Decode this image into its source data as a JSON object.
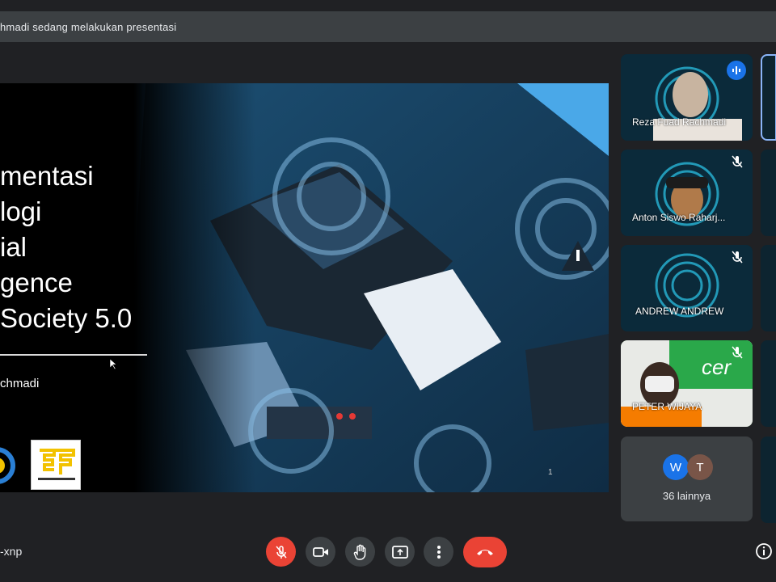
{
  "banner": {
    "text": "hmadi sedang melakukan presentasi"
  },
  "slide": {
    "title_lines": [
      "mentasi",
      "logi",
      "ial",
      "gence",
      "Society 5.0"
    ],
    "author": "chmadi",
    "page_number": "1"
  },
  "participants": [
    {
      "name": "Reza Fuad Rachmadi",
      "speaking": true
    },
    {
      "name": "Anton Siswo Raharj...",
      "muted": true
    },
    {
      "name": "ANDREW ANDREW",
      "muted": true
    },
    {
      "name": "PETER WIJAYA",
      "muted": true
    }
  ],
  "more_participants": {
    "avatars": [
      "W",
      "T"
    ],
    "avatar_colors": [
      "#1a73e8",
      "#795548"
    ],
    "label": "36 lainnya"
  },
  "meeting": {
    "code": "-xnp"
  },
  "controls": {
    "mic": "mic-off-icon",
    "camera": "videocam-icon",
    "hand": "raise-hand-icon",
    "present": "present-screen-icon",
    "more": "more-vert-icon",
    "end": "call-end-icon",
    "info": "info-icon"
  },
  "colors": {
    "accent": "#1a73e8",
    "danger": "#ea4335",
    "surface": "#3c4043",
    "background": "#202124"
  }
}
